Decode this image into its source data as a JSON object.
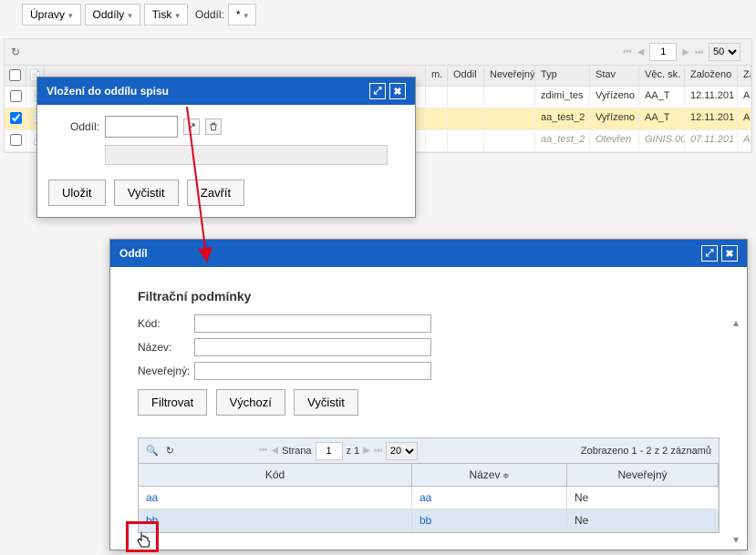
{
  "toolbar": {
    "upravy": "Úpravy",
    "oddily": "Oddíly",
    "tisk": "Tisk",
    "oddil_label": "Oddíl:",
    "oddil_value": "*"
  },
  "outer_grid": {
    "pager_page": "1",
    "pager_size": "50",
    "headers": {
      "m": "m.",
      "oddil": "Oddil",
      "neverejny": "Neveřejný",
      "typ": "Typ",
      "stav": "Stav",
      "vec_sk": "Věc. sk.",
      "zalozeno": "Založeno",
      "za": "Za"
    },
    "rows": [
      {
        "checked": false,
        "typ": "zdimi_tes",
        "stav": "Vyřízeno",
        "vec": "AA_T",
        "zalozeno": "12.11.201",
        "za": "Adm"
      },
      {
        "checked": true,
        "typ": "aa_test_2",
        "stav": "Vyřízeno",
        "vec": "AA_T",
        "zalozeno": "12.11.201",
        "za": "Adm",
        "highlight": true
      },
      {
        "checked": false,
        "typ": "aa_test_2",
        "stav": "Otevřen",
        "vec": "GINIS.00",
        "zalozeno": "07.11.201",
        "za": "Adm",
        "muted": true
      }
    ]
  },
  "dlg1": {
    "title": "Vložení do oddílu spisu",
    "oddil_label": "Oddíl:",
    "btn_save": "Uložit",
    "btn_clear": "Vyčistit",
    "btn_close": "Zavřít"
  },
  "dlg2": {
    "title": "Oddíl",
    "filter_title": "Filtrační podmínky",
    "kod_label": "Kód:",
    "nazev_label": "Název:",
    "neverejny_label": "Neveřejný:",
    "btn_filter": "Filtrovat",
    "btn_default": "Výchozí",
    "btn_clear": "Vyčistit",
    "pager": {
      "strana_label": "Strana",
      "page": "1",
      "z_label": "z 1",
      "size": "20",
      "shown": "Zobrazeno 1 - 2 z 2 záznamů"
    },
    "cols": {
      "kod": "Kód",
      "nazev": "Název",
      "neverejny": "Neveřejný"
    },
    "rows": [
      {
        "kod": "aa",
        "nazev": "aa",
        "neverejny": "Ne"
      },
      {
        "kod": "bb",
        "nazev": "bb",
        "neverejny": "Ne",
        "selected": true
      }
    ]
  }
}
